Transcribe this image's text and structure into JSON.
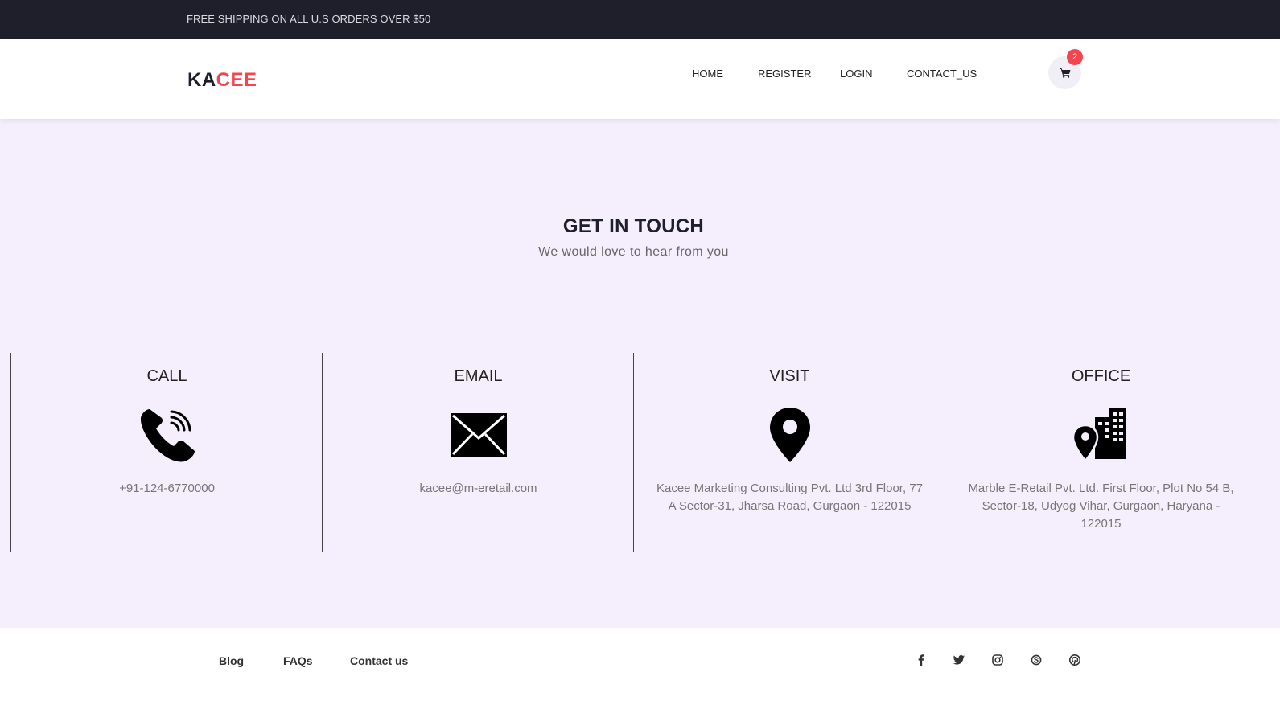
{
  "promo": {
    "text": "FREE SHIPPING ON ALL U.S ORDERS OVER $50"
  },
  "header": {
    "logo_part1": "KA",
    "logo_part2": "CEE",
    "nav": {
      "home": "HOME",
      "register": "REGISTER",
      "login": "LOGIN",
      "contact": "CONTACT_US"
    },
    "cart_count": "2"
  },
  "contact": {
    "title": "GET IN TOUCH",
    "subtitle": "We would love to hear from you",
    "cards": [
      {
        "title": "CALL",
        "icon": "phone-icon",
        "text": "+91-124-6770000"
      },
      {
        "title": "EMAIL",
        "icon": "envelope-icon",
        "text": "kacee@m-eretail.com"
      },
      {
        "title": "VISIT",
        "icon": "map-marker-icon",
        "text": "Kacee Marketing Consulting Pvt. Ltd 3rd Floor, 77 A Sector-31, Jharsa Road, Gurgaon - 122015"
      },
      {
        "title": "OFFICE",
        "icon": "building-location-icon",
        "text": "Marble E-Retail Pvt. Ltd. First Floor, Plot No 54 B, Sector-18, Udyog Vihar, Gurgaon, Haryana - 122015"
      }
    ]
  },
  "footer": {
    "links": {
      "blog": "Blog",
      "faqs": "FAQs",
      "contact": "Contact us"
    },
    "social": [
      "facebook-icon",
      "twitter-icon",
      "instagram-icon",
      "skype-icon",
      "pinterest-icon"
    ]
  },
  "colors": {
    "promo_bg": "#1f1e2b",
    "accent": "#f6444f",
    "section_bg": "#f4eefd"
  }
}
